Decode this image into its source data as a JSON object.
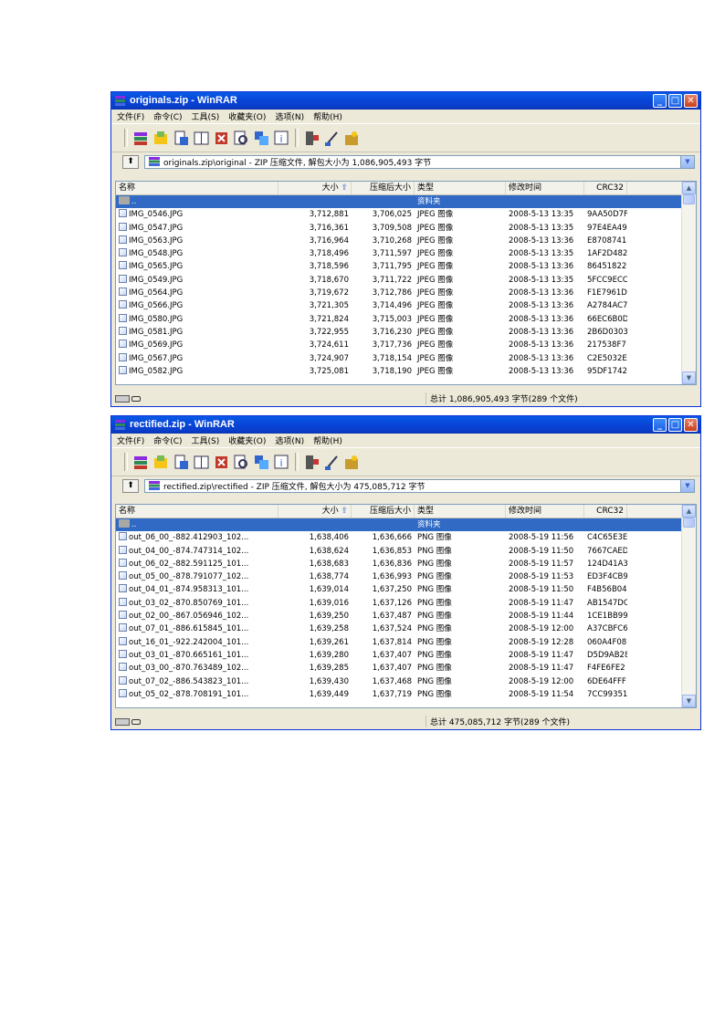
{
  "window1": {
    "title": "originals.zip - WinRAR",
    "menu": [
      "文件(F)",
      "命令(C)",
      "工具(S)",
      "收藏夹(O)",
      "选项(N)",
      "帮助(H)"
    ],
    "address": "originals.zip\\original - ZIP 压缩文件, 解包大小为 1,086,905,493 字节",
    "columns": {
      "name": "名称",
      "size": "大小",
      "packed": "压缩后大小",
      "type": "类型",
      "modified": "修改时间",
      "crc": "CRC32"
    },
    "parent": {
      "name": "..",
      "type": "资料夹"
    },
    "rows": [
      {
        "name": "IMG_0546.JPG",
        "size": "3,712,881",
        "packed": "3,706,025",
        "type": "JPEG 图像",
        "modified": "2008-5-13 13:35",
        "crc": "9AA50D7F"
      },
      {
        "name": "IMG_0547.JPG",
        "size": "3,716,361",
        "packed": "3,709,508",
        "type": "JPEG 图像",
        "modified": "2008-5-13 13:35",
        "crc": "97E4EA49"
      },
      {
        "name": "IMG_0563.JPG",
        "size": "3,716,964",
        "packed": "3,710,268",
        "type": "JPEG 图像",
        "modified": "2008-5-13 13:36",
        "crc": "E8708741"
      },
      {
        "name": "IMG_0548.JPG",
        "size": "3,718,496",
        "packed": "3,711,597",
        "type": "JPEG 图像",
        "modified": "2008-5-13 13:35",
        "crc": "1AF2D482"
      },
      {
        "name": "IMG_0565.JPG",
        "size": "3,718,596",
        "packed": "3,711,795",
        "type": "JPEG 图像",
        "modified": "2008-5-13 13:36",
        "crc": "86451822"
      },
      {
        "name": "IMG_0549.JPG",
        "size": "3,718,670",
        "packed": "3,711,722",
        "type": "JPEG 图像",
        "modified": "2008-5-13 13:35",
        "crc": "5FCC9ECC"
      },
      {
        "name": "IMG_0564.JPG",
        "size": "3,719,672",
        "packed": "3,712,786",
        "type": "JPEG 图像",
        "modified": "2008-5-13 13:36",
        "crc": "F1E7961D"
      },
      {
        "name": "IMG_0566.JPG",
        "size": "3,721,305",
        "packed": "3,714,496",
        "type": "JPEG 图像",
        "modified": "2008-5-13 13:36",
        "crc": "A2784AC7"
      },
      {
        "name": "IMG_0580.JPG",
        "size": "3,721,824",
        "packed": "3,715,003",
        "type": "JPEG 图像",
        "modified": "2008-5-13 13:36",
        "crc": "66EC6B0D"
      },
      {
        "name": "IMG_0581.JPG",
        "size": "3,722,955",
        "packed": "3,716,230",
        "type": "JPEG 图像",
        "modified": "2008-5-13 13:36",
        "crc": "2B6D0303"
      },
      {
        "name": "IMG_0569.JPG",
        "size": "3,724,611",
        "packed": "3,717,736",
        "type": "JPEG 图像",
        "modified": "2008-5-13 13:36",
        "crc": "217538F7"
      },
      {
        "name": "IMG_0567.JPG",
        "size": "3,724,907",
        "packed": "3,718,154",
        "type": "JPEG 图像",
        "modified": "2008-5-13 13:36",
        "crc": "C2E5032E"
      },
      {
        "name": "IMG_0582.JPG",
        "size": "3,725,081",
        "packed": "3,718,190",
        "type": "JPEG 图像",
        "modified": "2008-5-13 13:36",
        "crc": "95DF1742"
      }
    ],
    "status": "总计 1,086,905,493 字节(289 个文件)"
  },
  "window2": {
    "title": "rectified.zip - WinRAR",
    "menu": [
      "文件(F)",
      "命令(C)",
      "工具(S)",
      "收藏夹(O)",
      "选项(N)",
      "帮助(H)"
    ],
    "address": "rectified.zip\\rectified - ZIP 压缩文件, 解包大小为 475,085,712 字节",
    "columns": {
      "name": "名称",
      "size": "大小",
      "packed": "压缩后大小",
      "type": "类型",
      "modified": "修改时间",
      "crc": "CRC32"
    },
    "parent": {
      "name": "..",
      "type": "资料夹"
    },
    "rows": [
      {
        "name": "out_06_00_-882.412903_102...",
        "size": "1,638,406",
        "packed": "1,636,666",
        "type": "PNG 图像",
        "modified": "2008-5-19 11:56",
        "crc": "C4C65E3E"
      },
      {
        "name": "out_04_00_-874.747314_102...",
        "size": "1,638,624",
        "packed": "1,636,853",
        "type": "PNG 图像",
        "modified": "2008-5-19 11:50",
        "crc": "7667CAED"
      },
      {
        "name": "out_06_02_-882.591125_101...",
        "size": "1,638,683",
        "packed": "1,636,836",
        "type": "PNG 图像",
        "modified": "2008-5-19 11:57",
        "crc": "124D41A3"
      },
      {
        "name": "out_05_00_-878.791077_102...",
        "size": "1,638,774",
        "packed": "1,636,993",
        "type": "PNG 图像",
        "modified": "2008-5-19 11:53",
        "crc": "ED3F4CB9"
      },
      {
        "name": "out_04_01_-874.958313_101...",
        "size": "1,639,014",
        "packed": "1,637,250",
        "type": "PNG 图像",
        "modified": "2008-5-19 11:50",
        "crc": "F4B56B04"
      },
      {
        "name": "out_03_02_-870.850769_101...",
        "size": "1,639,016",
        "packed": "1,637,126",
        "type": "PNG 图像",
        "modified": "2008-5-19 11:47",
        "crc": "AB1547DC"
      },
      {
        "name": "out_02_00_-867.056946_102...",
        "size": "1,639,250",
        "packed": "1,637,487",
        "type": "PNG 图像",
        "modified": "2008-5-19 11:44",
        "crc": "1CE1BB99"
      },
      {
        "name": "out_07_01_-886.615845_101...",
        "size": "1,639,258",
        "packed": "1,637,524",
        "type": "PNG 图像",
        "modified": "2008-5-19 12:00",
        "crc": "A37CBFC6"
      },
      {
        "name": "out_16_01_-922.242004_101...",
        "size": "1,639,261",
        "packed": "1,637,814",
        "type": "PNG 图像",
        "modified": "2008-5-19 12:28",
        "crc": "060A4F08"
      },
      {
        "name": "out_03_01_-870.665161_101...",
        "size": "1,639,280",
        "packed": "1,637,407",
        "type": "PNG 图像",
        "modified": "2008-5-19 11:47",
        "crc": "D5D9AB28"
      },
      {
        "name": "out_03_00_-870.763489_102...",
        "size": "1,639,285",
        "packed": "1,637,407",
        "type": "PNG 图像",
        "modified": "2008-5-19 11:47",
        "crc": "F4FE6FE2"
      },
      {
        "name": "out_07_02_-886.543823_101...",
        "size": "1,639,430",
        "packed": "1,637,468",
        "type": "PNG 图像",
        "modified": "2008-5-19 12:00",
        "crc": "6DE64FFF"
      },
      {
        "name": "out_05_02_-878.708191_101...",
        "size": "1,639,449",
        "packed": "1,637,719",
        "type": "PNG 图像",
        "modified": "2008-5-19 11:54",
        "crc": "7CC99351"
      }
    ],
    "status": "总计 475,085,712 字节(289 个文件)"
  },
  "icons": [
    "winrar-app-icon",
    "add-icon",
    "extract-to-icon",
    "test-icon",
    "view-icon",
    "delete-icon",
    "find-icon",
    "wizard-icon",
    "info-icon",
    "virus-scan-icon",
    "comment-icon",
    "sfx-icon",
    "up-folder-icon"
  ],
  "colors": {
    "titlebar": "#0846d8",
    "selection": "#316ac5",
    "chrome": "#ece9d8"
  }
}
